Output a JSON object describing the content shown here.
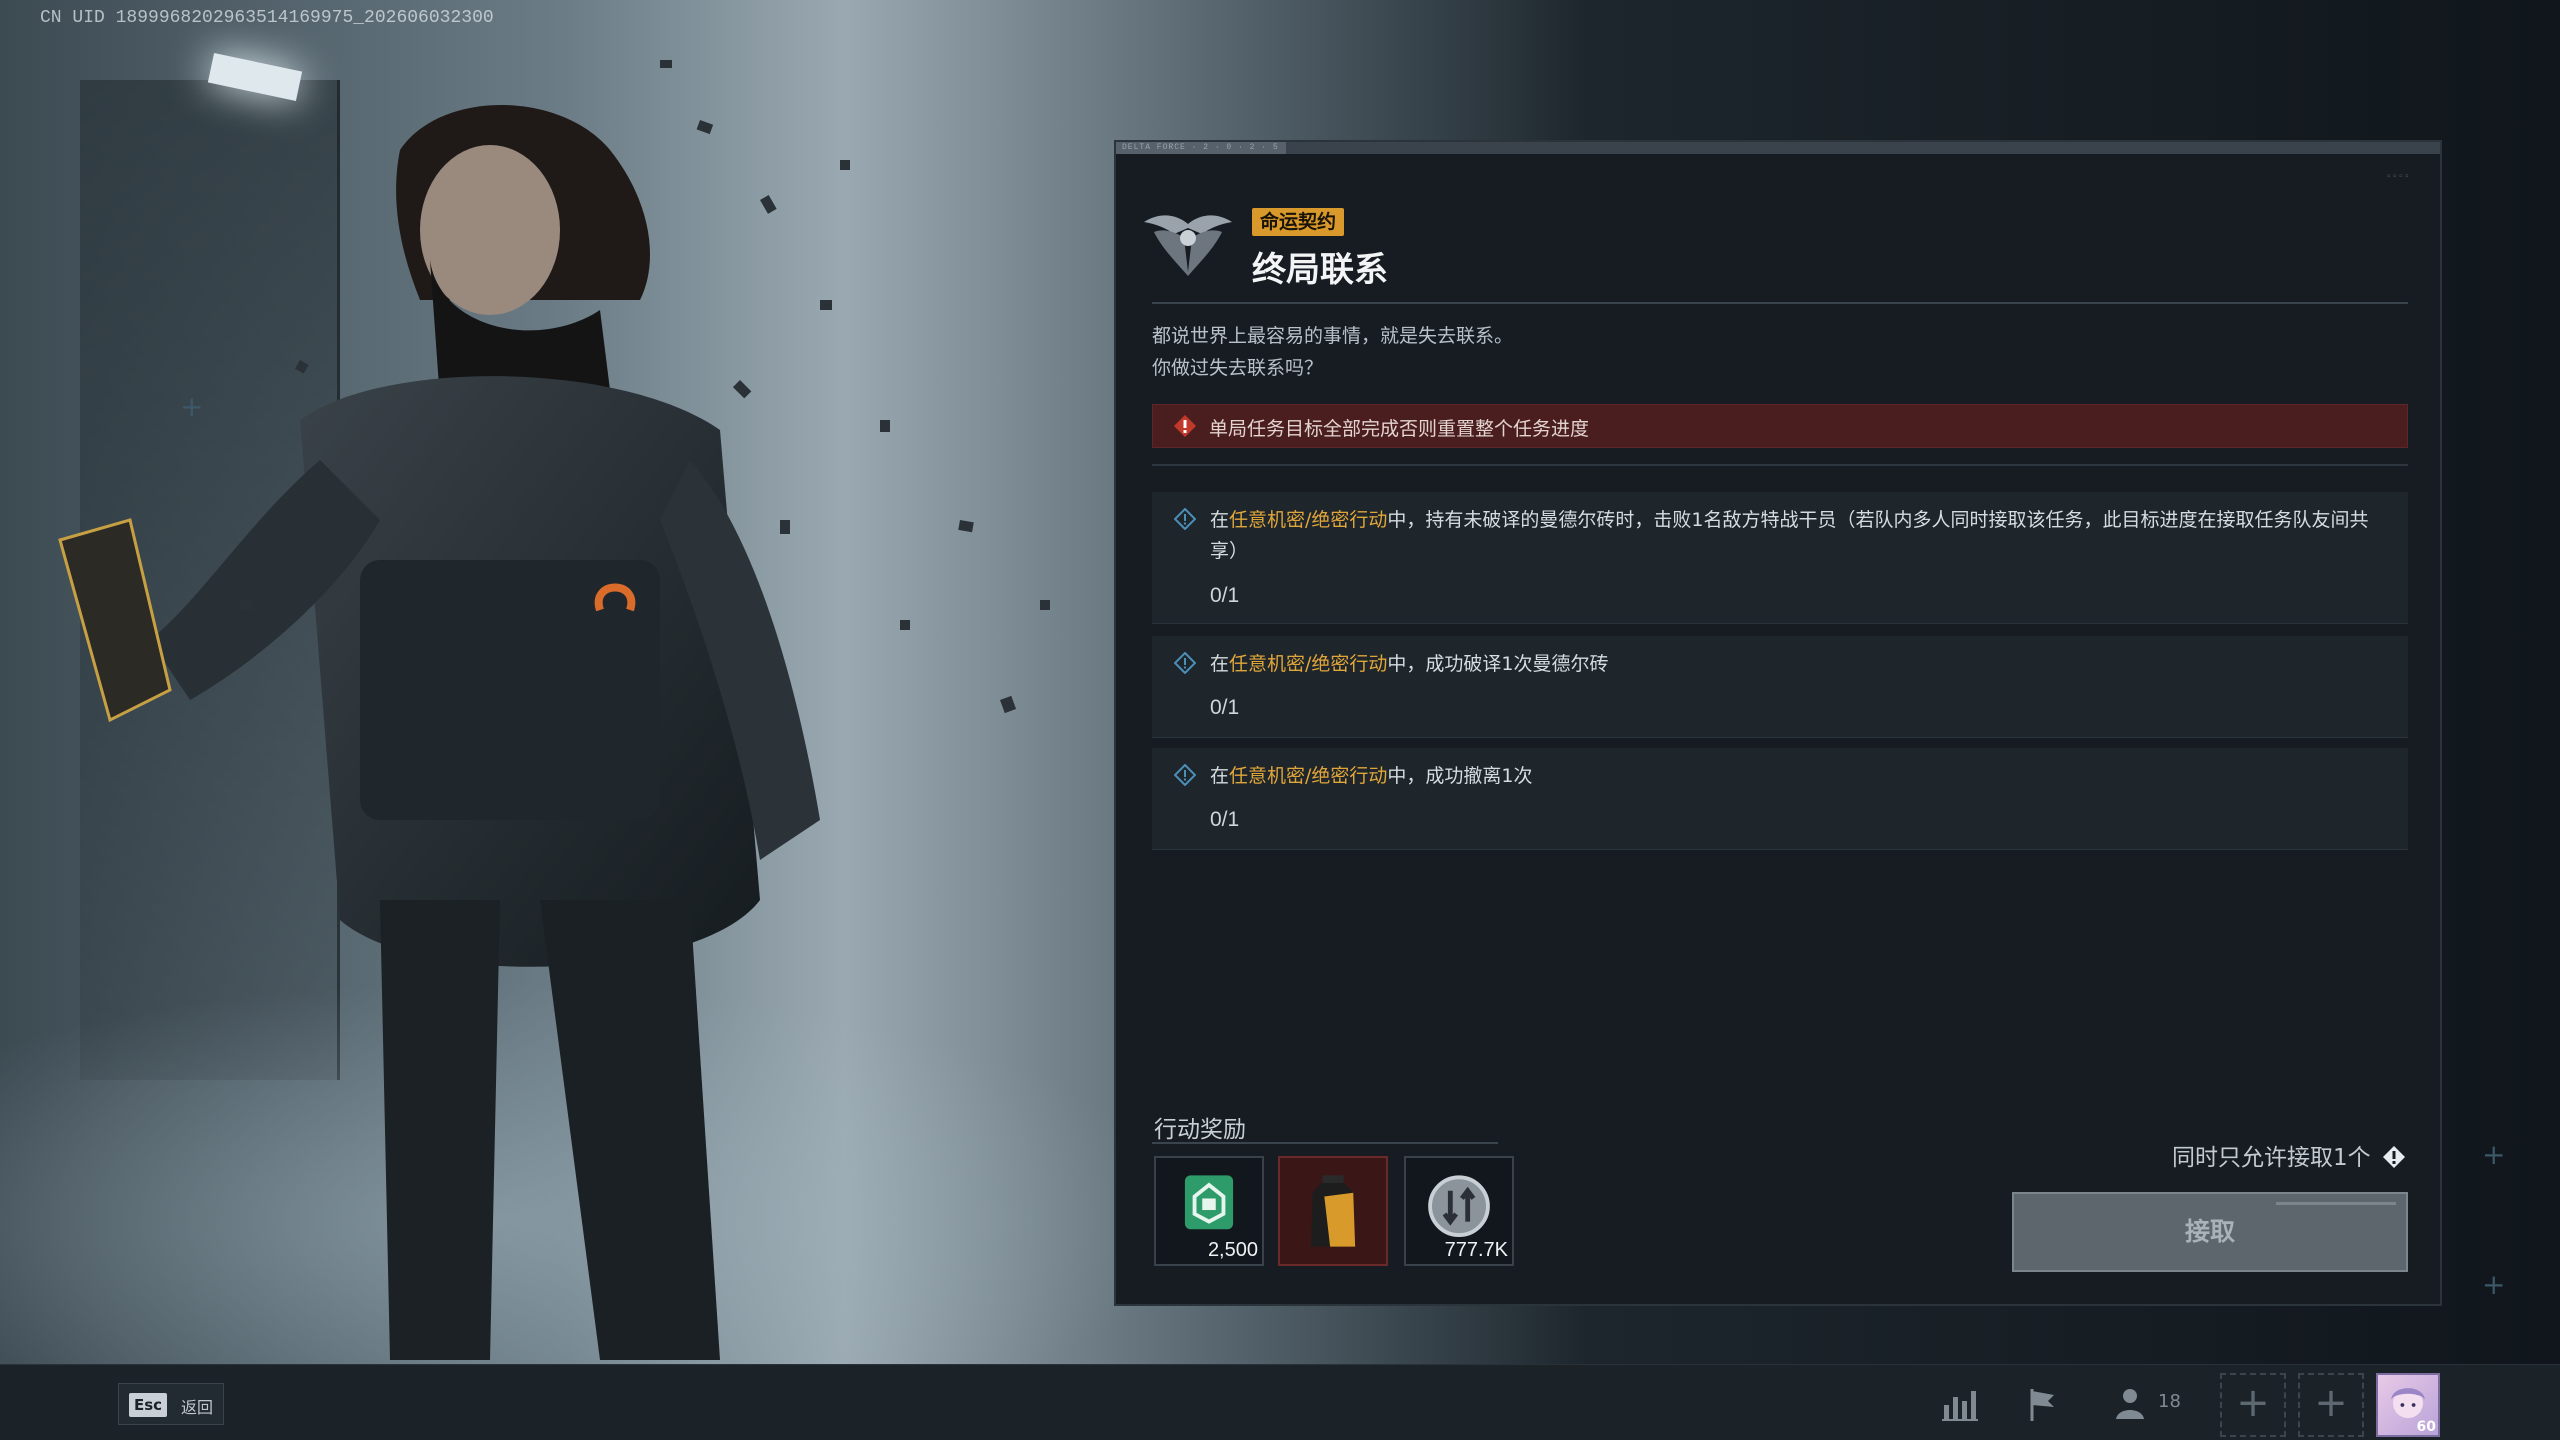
{
  "uid_text": "CN UID 1899968202963514169975_202606032300",
  "panel": {
    "top_tag": "DELTA FORCE · 2 · 0 · 2 · 5",
    "badge": "命运契约",
    "title": "终局联系",
    "description": [
      "都说世界上最容易的事情，就是失去联系。",
      "你做过失去联系吗？"
    ],
    "warning": "单局任务目标全部完成否则重置整个任务进度",
    "objectives": [
      {
        "prefix": "在",
        "highlight": "任意机密/绝密行动",
        "suffix": "中，持有未破译的曼德尔砖时，击败1名敌方特战干员（若队内多人同时接取该任务，此目标进度在接取任务队友间共享）",
        "progress": "0/1"
      },
      {
        "prefix": "在",
        "highlight": "任意机密/绝密行动",
        "suffix": "中，成功破译1次曼德尔砖",
        "progress": "0/1"
      },
      {
        "prefix": "在",
        "highlight": "任意机密/绝密行动",
        "suffix": "中，成功撤离1次",
        "progress": "0/1"
      }
    ],
    "rewards_label": "行动奖励",
    "rewards": [
      {
        "icon": "experience-card-icon",
        "count": "2,500",
        "color": "#2e9b6a"
      },
      {
        "icon": "supply-bag-icon",
        "count": "",
        "color": "#d89a2a"
      },
      {
        "icon": "currency-coin-icon",
        "count": "777.7K",
        "color": "#9aa3ab"
      }
    ],
    "limit_text": "同时只允许接取1个",
    "accept_label": "接取"
  },
  "bottombar": {
    "esc_key": "Esc",
    "esc_label": "返回",
    "friends_count": "18",
    "avatar_level": "60"
  },
  "colors": {
    "accent_orange": "#e1a63a",
    "warning_red": "#c0392b",
    "panel_bg": "#161c22"
  }
}
